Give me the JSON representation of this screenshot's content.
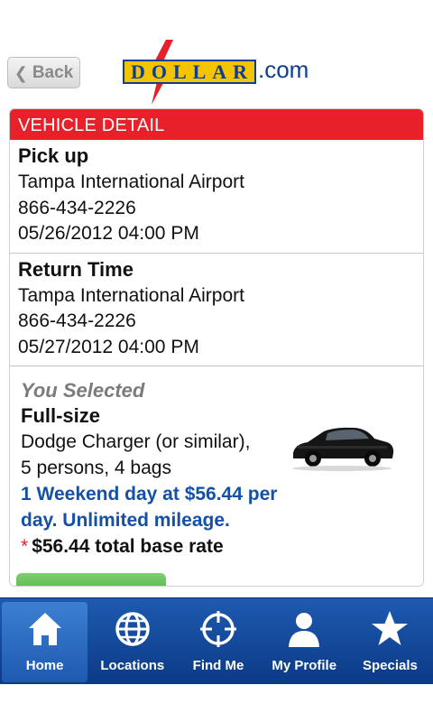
{
  "header": {
    "back_label": "Back",
    "logo": {
      "letters": [
        "D",
        "O",
        "L",
        "L",
        "A",
        "R"
      ],
      "suffix": ".com"
    }
  },
  "detail": {
    "title": "VEHICLE DETAIL",
    "pickup": {
      "heading": "Pick up",
      "location": "Tampa International Airport",
      "phone": "866-434-2226",
      "datetime": "05/26/2012 04:00 PM"
    },
    "return": {
      "heading": "Return Time",
      "location": "Tampa International Airport",
      "phone": "866-434-2226",
      "datetime": "05/27/2012 04:00 PM"
    },
    "selected": {
      "label": "You Selected",
      "class": "Full-size",
      "car": "Dodge Charger (or similar),",
      "capacity": "5 persons, 4 bags",
      "rate": "1 Weekend day at $56.44 per day. Unlimited mileage.",
      "asterisk": "*",
      "total": "$56.44 total base rate"
    }
  },
  "tabs": [
    {
      "label": "Home",
      "icon": "home-icon"
    },
    {
      "label": "Locations",
      "icon": "globe-icon"
    },
    {
      "label": "Find Me",
      "icon": "crosshair-icon"
    },
    {
      "label": "My Profile",
      "icon": "person-icon"
    },
    {
      "label": "Specials",
      "icon": "star-icon"
    }
  ],
  "colors": {
    "brand_red": "#e8202a",
    "brand_blue": "#0a3f92",
    "brand_yellow": "#f5c400",
    "rate_blue": "#1450a6",
    "tab_blue": "#1e5ab0"
  }
}
